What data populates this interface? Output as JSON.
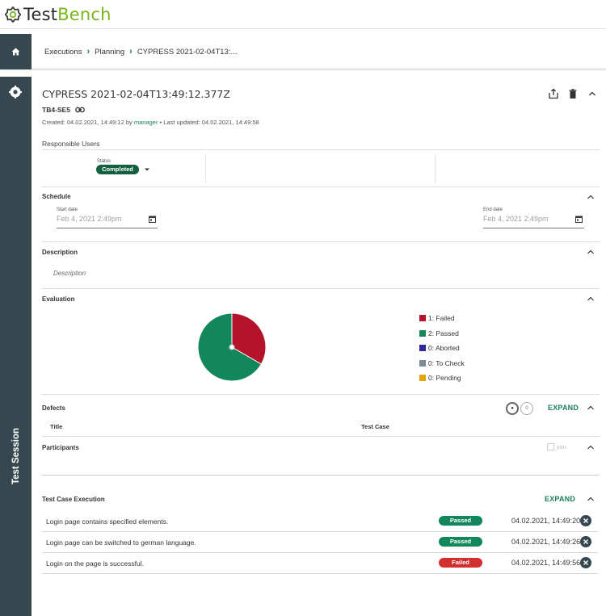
{
  "app": {
    "logo_prefix": "Test",
    "logo_accent": "Bench",
    "brand_color": "#7ab51d",
    "accent_color": "#1b7f5a"
  },
  "breadcrumb": {
    "items": [
      "Executions",
      "Planning",
      "CYPRESS 2021-02-04T13:..."
    ]
  },
  "sidebar": {
    "label": "Test Session",
    "icon": "gear-badge-icon",
    "home_icon": "home-icon"
  },
  "session": {
    "title": "CYPRESS 2021-02-04T13:49:12.377Z",
    "id": "TB4-SE5",
    "meta_created": "Created: 04.02.2021, 14:49:12 by ",
    "meta_user": "manager",
    "meta_updated": " • Last updated: 04.02.2021, 14:49:58",
    "responsible_label": "Responsible Users",
    "status_label": "Status",
    "status_value": "Completed"
  },
  "schedule": {
    "title": "Schedule",
    "start_label": "Start date",
    "start_value": "Feb 4, 2021 2:49pm",
    "end_label": "End date",
    "end_value": "Feb 4, 2021 2:49pm"
  },
  "description": {
    "title": "Description",
    "placeholder": "Description"
  },
  "evaluation": {
    "title": "Evaluation",
    "legend": [
      {
        "label": "1: Failed",
        "color": "#b5132c"
      },
      {
        "label": "2: Passed",
        "color": "#12875b"
      },
      {
        "label": "0: Aborted",
        "color": "#2c2a93"
      },
      {
        "label": "0: To Check",
        "color": "#7c8c94"
      },
      {
        "label": "0: Pending",
        "color": "#e0a40f"
      }
    ]
  },
  "chart_data": {
    "type": "pie",
    "categories": [
      "Failed",
      "Passed",
      "Aborted",
      "To Check",
      "Pending"
    ],
    "values": [
      1,
      2,
      0,
      0,
      0
    ],
    "colors": [
      "#b5132c",
      "#12875b",
      "#2c2a93",
      "#7c8c94",
      "#e0a40f"
    ]
  },
  "defects": {
    "title": "Defects",
    "expand_label": "EXPAND",
    "toggle_left": "●",
    "toggle_right": "0",
    "col_title": "Title",
    "col_testcase": "Test Case"
  },
  "participants": {
    "title": "Participants",
    "join_label": "join"
  },
  "test_case_execution": {
    "title": "Test Case Execution",
    "expand_label": "EXPAND",
    "rows": [
      {
        "name": "Login page contains specified elements.",
        "status": "Passed",
        "status_color": "#12875b",
        "time": "04.02.2021, 14:49:20"
      },
      {
        "name": "Login page can be switched to german language.",
        "status": "Passed",
        "status_color": "#12875b",
        "time": "04.02.2021, 14:49:26"
      },
      {
        "name": "Login on the page is successful.",
        "status": "Failed",
        "status_color": "#d32f2f",
        "time": "04.02.2021, 14:49:56"
      }
    ]
  }
}
